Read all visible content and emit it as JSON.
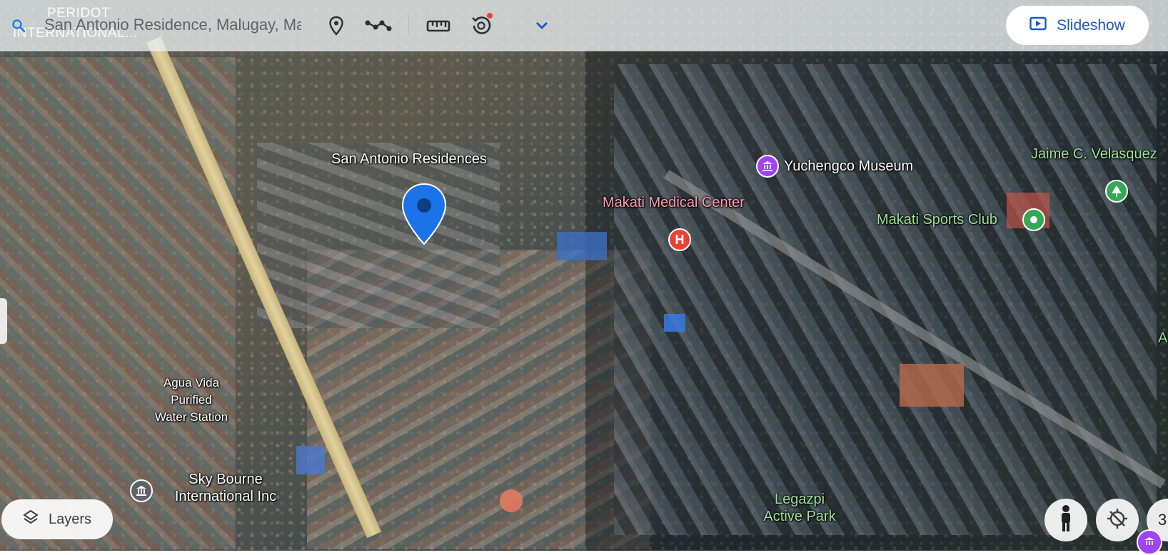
{
  "toolbar": {
    "search_text": "San Antonio Residence, Malugay, Makati...",
    "ghost_line1": "PERIDOT",
    "ghost_line2": "INTERNATIONAL...",
    "slideshow_label": "Slideshow"
  },
  "map_labels": {
    "san_antonio": "San Antonio Residences",
    "yuchengco": "Yuchengco Museum",
    "makati_medical": "Makati Medical Center",
    "jaime": "Jaime C. Velasquez",
    "makati_sports": "Makati Sports Club",
    "agua_vida_1": "Agua Vida",
    "agua_vida_2": "Purified",
    "agua_vida_3": "Water Station",
    "sky_bourne_1": "Sky Bourne",
    "sky_bourne_2": "International Inc",
    "legazpi_1": "Legazpi",
    "legazpi_2": "Active Park",
    "edge_a": "A"
  },
  "controls": {
    "layers_label": "Layers",
    "tilt_label": "3"
  },
  "colors": {
    "pin": "#1a73e8",
    "hospital": "#ea4335",
    "museum": "#a142f4",
    "park": "#34a853",
    "accent": "#1a57c7"
  },
  "icons": [
    "search-icon",
    "location-pin-icon",
    "path-icon",
    "ruler-icon",
    "history-icon",
    "chevron-down-icon",
    "slideshow-icon",
    "layers-icon",
    "pegman-icon",
    "compass-off-icon"
  ]
}
